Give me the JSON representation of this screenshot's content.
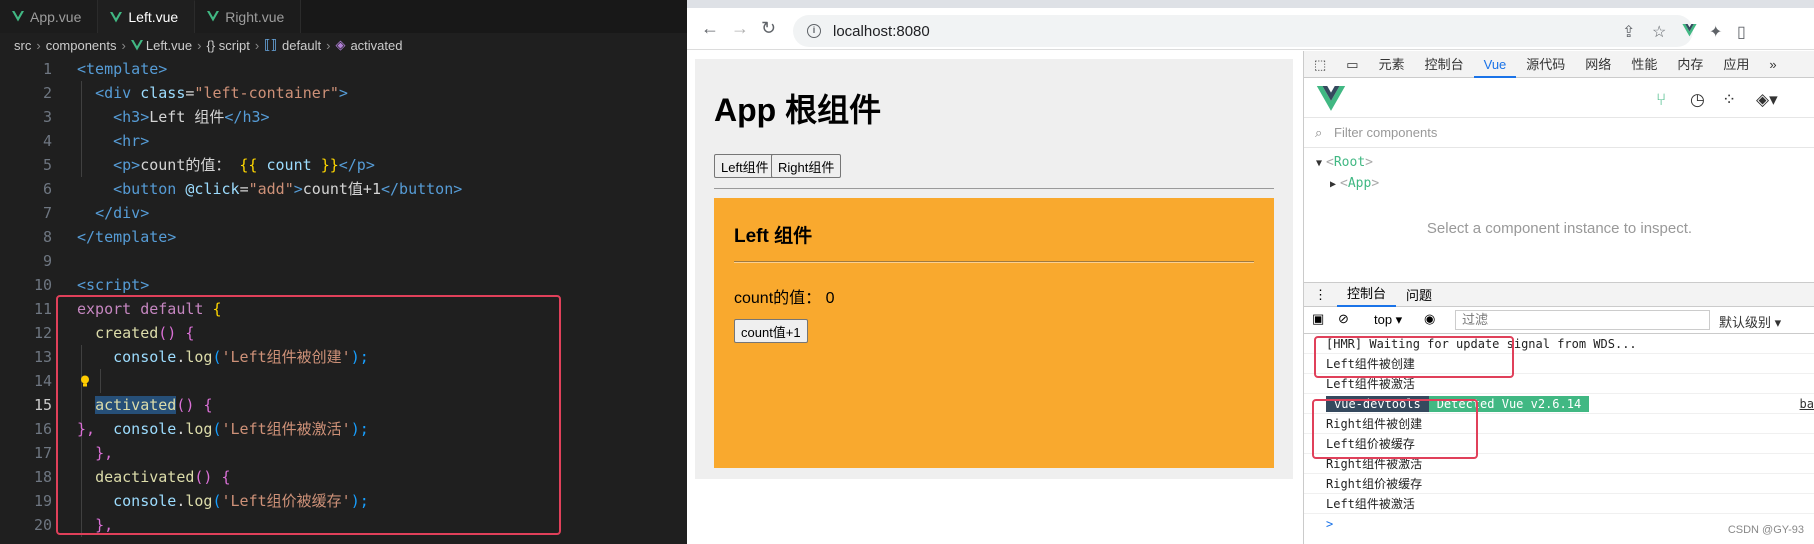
{
  "editor": {
    "tabs": [
      {
        "label": "App.vue"
      },
      {
        "label": "Left.vue"
      },
      {
        "label": "Right.vue"
      }
    ],
    "breadcrumb": {
      "src": "src",
      "components": "components",
      "file": "Left.vue",
      "script": "{} script",
      "default": "default",
      "activated": "activated"
    },
    "line_numbers": [
      "1",
      "2",
      "3",
      "4",
      "5",
      "6",
      "7",
      "8",
      "9",
      "10",
      "11",
      "12",
      "13",
      "14",
      "15",
      "16",
      "17",
      "18",
      "19",
      "20"
    ],
    "code": {
      "l1": "<template>",
      "l2_a": "<div ",
      "l2_attr": "class",
      "l2_eq": "=",
      "l2_val": "\"left-container\"",
      "l2_b": ">",
      "l3_a": "<h3>",
      "l3_t": "Left 组件",
      "l3_b": "</h3>",
      "l4": "<hr>",
      "l5_a": "<p>",
      "l5_t": "count的值：",
      "l5_m1": "{{",
      "l5_v": " count ",
      "l5_m2": "}}",
      "l5_b": "</p>",
      "l6_a": "<button ",
      "l6_attr": "@click",
      "l6_eq": "=",
      "l6_val": "\"add\"",
      "l6_b": ">",
      "l6_t": "count值+1",
      "l6_c": "</button>",
      "l7": "</div>",
      "l8": "</template>",
      "l10": "<script>",
      "l11_kw": "export default ",
      "l11_br": "{",
      "l12_fn": "created",
      "l12_p": "() ",
      "l12_br": "{",
      "l13_obj": "console",
      "l13_dot": ".",
      "l13_m": "log",
      "l13_p1": "(",
      "l13_s": "'Left组件被创建'",
      "l13_p2": ");",
      "l14": "},",
      "l15_fn": "activated",
      "l15_p": "() ",
      "l15_br": "{",
      "l16_obj": "console",
      "l16_dot": ".",
      "l16_m": "log",
      "l16_p1": "(",
      "l16_s": "'Left组件被激活'",
      "l16_p2": ");",
      "l17": "},",
      "l18_fn": "deactivated",
      "l18_p": "() ",
      "l18_br": "{",
      "l19_obj": "console",
      "l19_dot": ".",
      "l19_m": "log",
      "l19_p1": "(",
      "l19_s": "'Left组价被缓存'",
      "l19_p2": ");",
      "l20": "},"
    }
  },
  "browser": {
    "url": "localhost:8080",
    "page": {
      "title": "App 根组件",
      "btn_left": "Left组件",
      "btn_right": "Right组件",
      "left_title": "Left 组件",
      "left_count_label": "count的值：",
      "left_count_value": "0",
      "left_button": "count值+1"
    },
    "devtools": {
      "tabs": [
        "元素",
        "控制台",
        "Vue",
        "源代码",
        "网络",
        "性能",
        "内存",
        "应用",
        "»"
      ],
      "filter_placeholder": "Filter components",
      "tree_root": "Root",
      "tree_app": "App",
      "inspect_placeholder": "Select a component instance to inspect.",
      "console_tabs": [
        "控制台",
        "问题"
      ],
      "context": "top ▾",
      "filter_text": "过滤",
      "level": "默认级别 ▾",
      "logs": {
        "hmr": "[HMR] Waiting for update signal from WDS...",
        "l1": "Left组件被创建",
        "l2": "Left组件被激活",
        "vt_badge": "vue-devtools",
        "vt_detected": "Detected Vue v2.6.14",
        "vt_src": "ba",
        "l3": "Right组件被创建",
        "l4": "Left组价被缓存",
        "l5": "Right组件被激活",
        "l6": "Right组价被缓存",
        "l7": "Left组件被激活"
      },
      "prompt": ">",
      "watermark": "CSDN @GY-93"
    }
  }
}
